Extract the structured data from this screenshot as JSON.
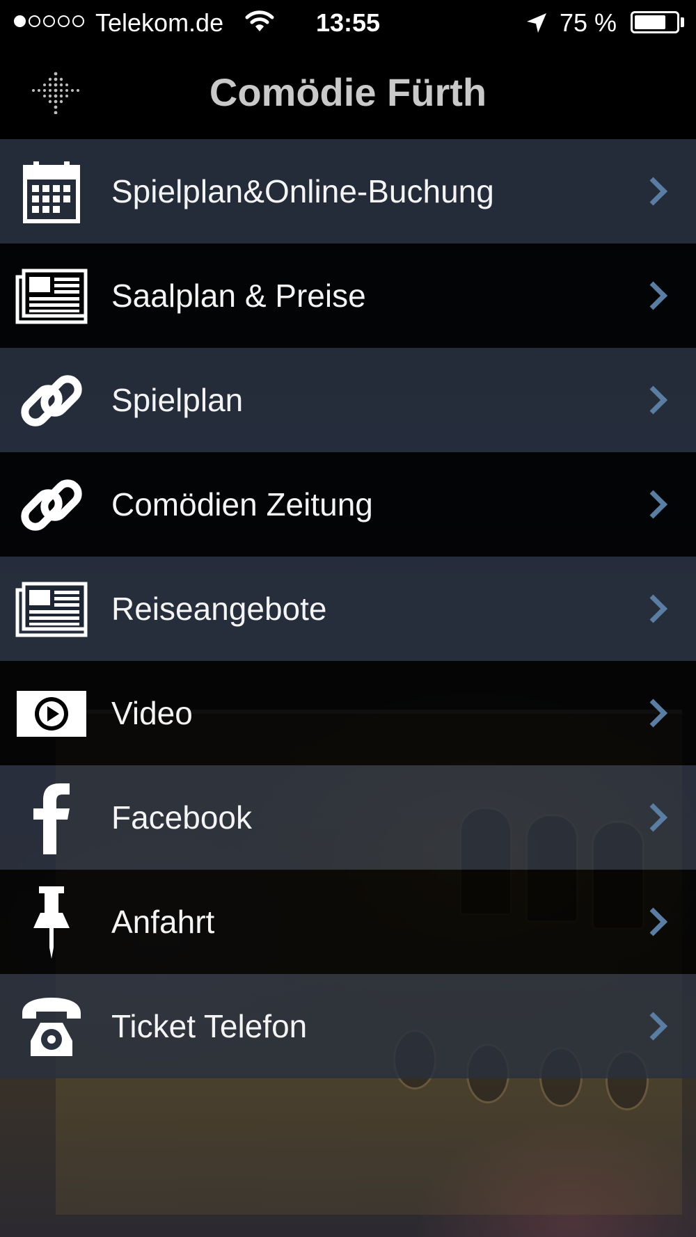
{
  "status_bar": {
    "carrier": "Telekom.de",
    "signal_strength": 1,
    "time": "13:55",
    "battery_percent": "75 %",
    "battery_level": 0.75,
    "icons": [
      "wifi-icon",
      "location-arrow-icon",
      "battery-icon"
    ]
  },
  "nav": {
    "title": "Comödie Fürth",
    "menu_icon": "dotted-menu-icon"
  },
  "menu": {
    "items": [
      {
        "label": "Spielplan&Online-Buchung",
        "icon": "calendar-icon"
      },
      {
        "label": "Saalplan & Preise",
        "icon": "newspaper-icon"
      },
      {
        "label": "Spielplan",
        "icon": "link-icon"
      },
      {
        "label": "Comödien Zeitung",
        "icon": "link-icon"
      },
      {
        "label": "Reiseangebote",
        "icon": "newspaper-icon"
      },
      {
        "label": "Video",
        "icon": "play-icon"
      },
      {
        "label": "Facebook",
        "icon": "facebook-icon"
      },
      {
        "label": "Anfahrt",
        "icon": "pushpin-icon"
      },
      {
        "label": "Ticket Telefon",
        "icon": "telephone-icon"
      }
    ],
    "chevron_color": "#5a7ea3"
  }
}
